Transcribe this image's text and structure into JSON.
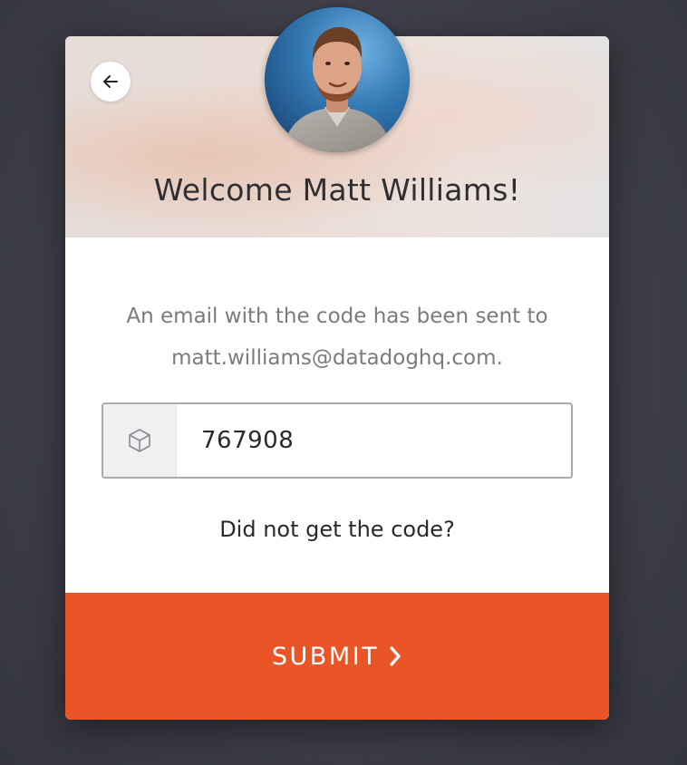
{
  "header": {
    "back_icon": "arrow-left-icon",
    "avatar_alt": "Matt Williams",
    "welcome_text": "Welcome Matt Williams!"
  },
  "message": {
    "line1": "An email with the code has been sent to",
    "line2": "matt.williams@datadoghq.com."
  },
  "code_field": {
    "icon": "cube-icon",
    "value": "767908"
  },
  "resend": {
    "label": "Did not get the code?"
  },
  "submit": {
    "label": "SUBMIT",
    "icon": "chevron-right-icon"
  },
  "colors": {
    "accent": "#ea5527",
    "background": "#3f4049",
    "card": "#ffffff"
  }
}
